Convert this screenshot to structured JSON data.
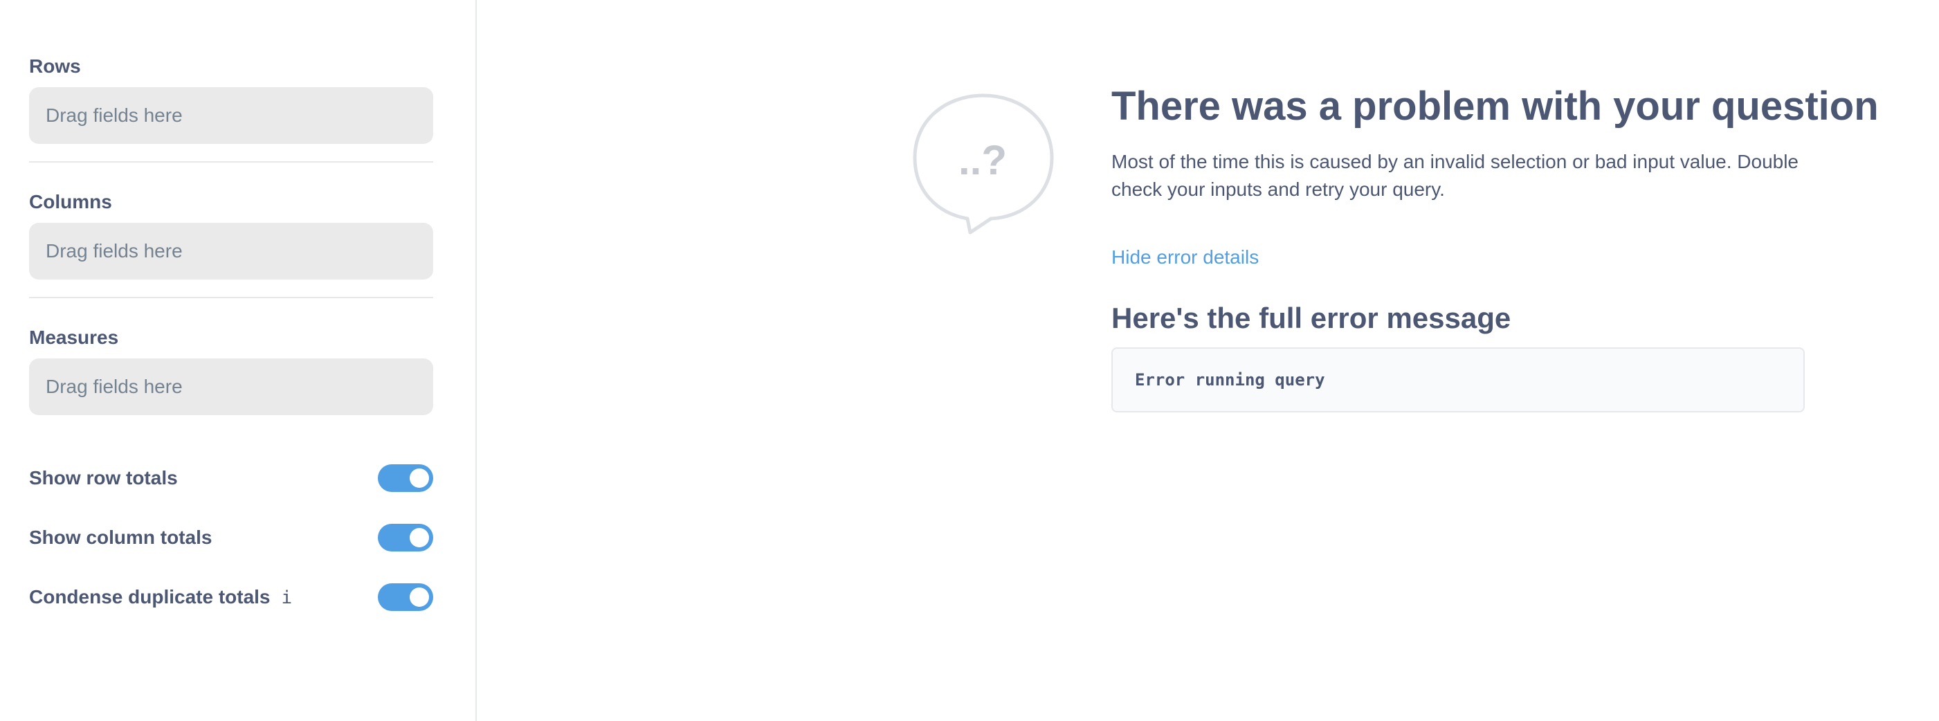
{
  "sidebar": {
    "rows": {
      "label": "Rows",
      "placeholder": "Drag fields here"
    },
    "columns": {
      "label": "Columns",
      "placeholder": "Drag fields here"
    },
    "measures": {
      "label": "Measures",
      "placeholder": "Drag fields here"
    },
    "toggles": [
      {
        "label": "Show row totals",
        "enabled": true
      },
      {
        "label": "Show column totals",
        "enabled": true
      },
      {
        "label": "Condense duplicate totals",
        "enabled": true,
        "info_icon": "i"
      }
    ]
  },
  "error": {
    "bubble_text": "..?",
    "title": "There was a problem with your question",
    "description": "Most of the time this is caused by an invalid selection or bad input value. Double check your inputs and retry your query.",
    "hide_details_label": "Hide error details",
    "full_message_heading": "Here's the full error message",
    "message": "Error running query"
  },
  "colors": {
    "accent": "#509ee3",
    "text": "#4c5773",
    "dropzone_bg": "#ebeaeb"
  }
}
